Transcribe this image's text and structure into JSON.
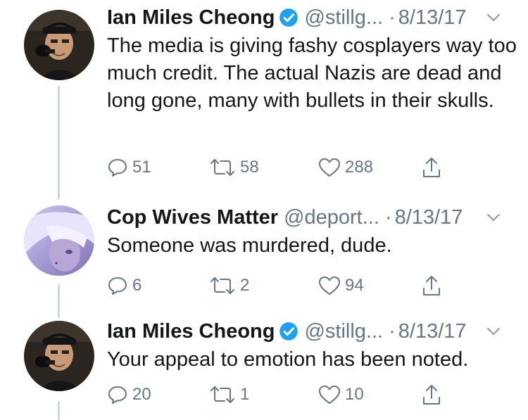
{
  "tweets": [
    {
      "name": "Ian Miles Cheong",
      "handle": "@stillg...",
      "separator": "·",
      "date": "8/13/17",
      "text": "The media is giving fashy cosplayers way too much credit. The actual Nazis are dead and long gone, many with bullets in their skulls.",
      "replies": "51",
      "retweets": "58",
      "likes": "288",
      "verified": true
    },
    {
      "name": "Cop Wives Matter",
      "handle": "@deport...",
      "separator": "·",
      "date": "8/13/17",
      "text": "Someone was murdered, dude.",
      "replies": "6",
      "retweets": "2",
      "likes": "94",
      "verified": false
    },
    {
      "name": "Ian Miles Cheong",
      "handle": "@stillg...",
      "separator": "·",
      "date": "8/13/17",
      "text": "Your appeal to emotion has been noted.",
      "replies": "20",
      "retweets": "1",
      "likes": "10",
      "verified": true
    }
  ],
  "colors": {
    "text": "#14171a",
    "secondary": "#657786",
    "verified": "#1da1f2",
    "thread_line": "#ccd6dd"
  },
  "icons": [
    "reply-icon",
    "retweet-icon",
    "like-icon",
    "share-icon",
    "verified-badge-icon",
    "chevron-down-icon"
  ]
}
